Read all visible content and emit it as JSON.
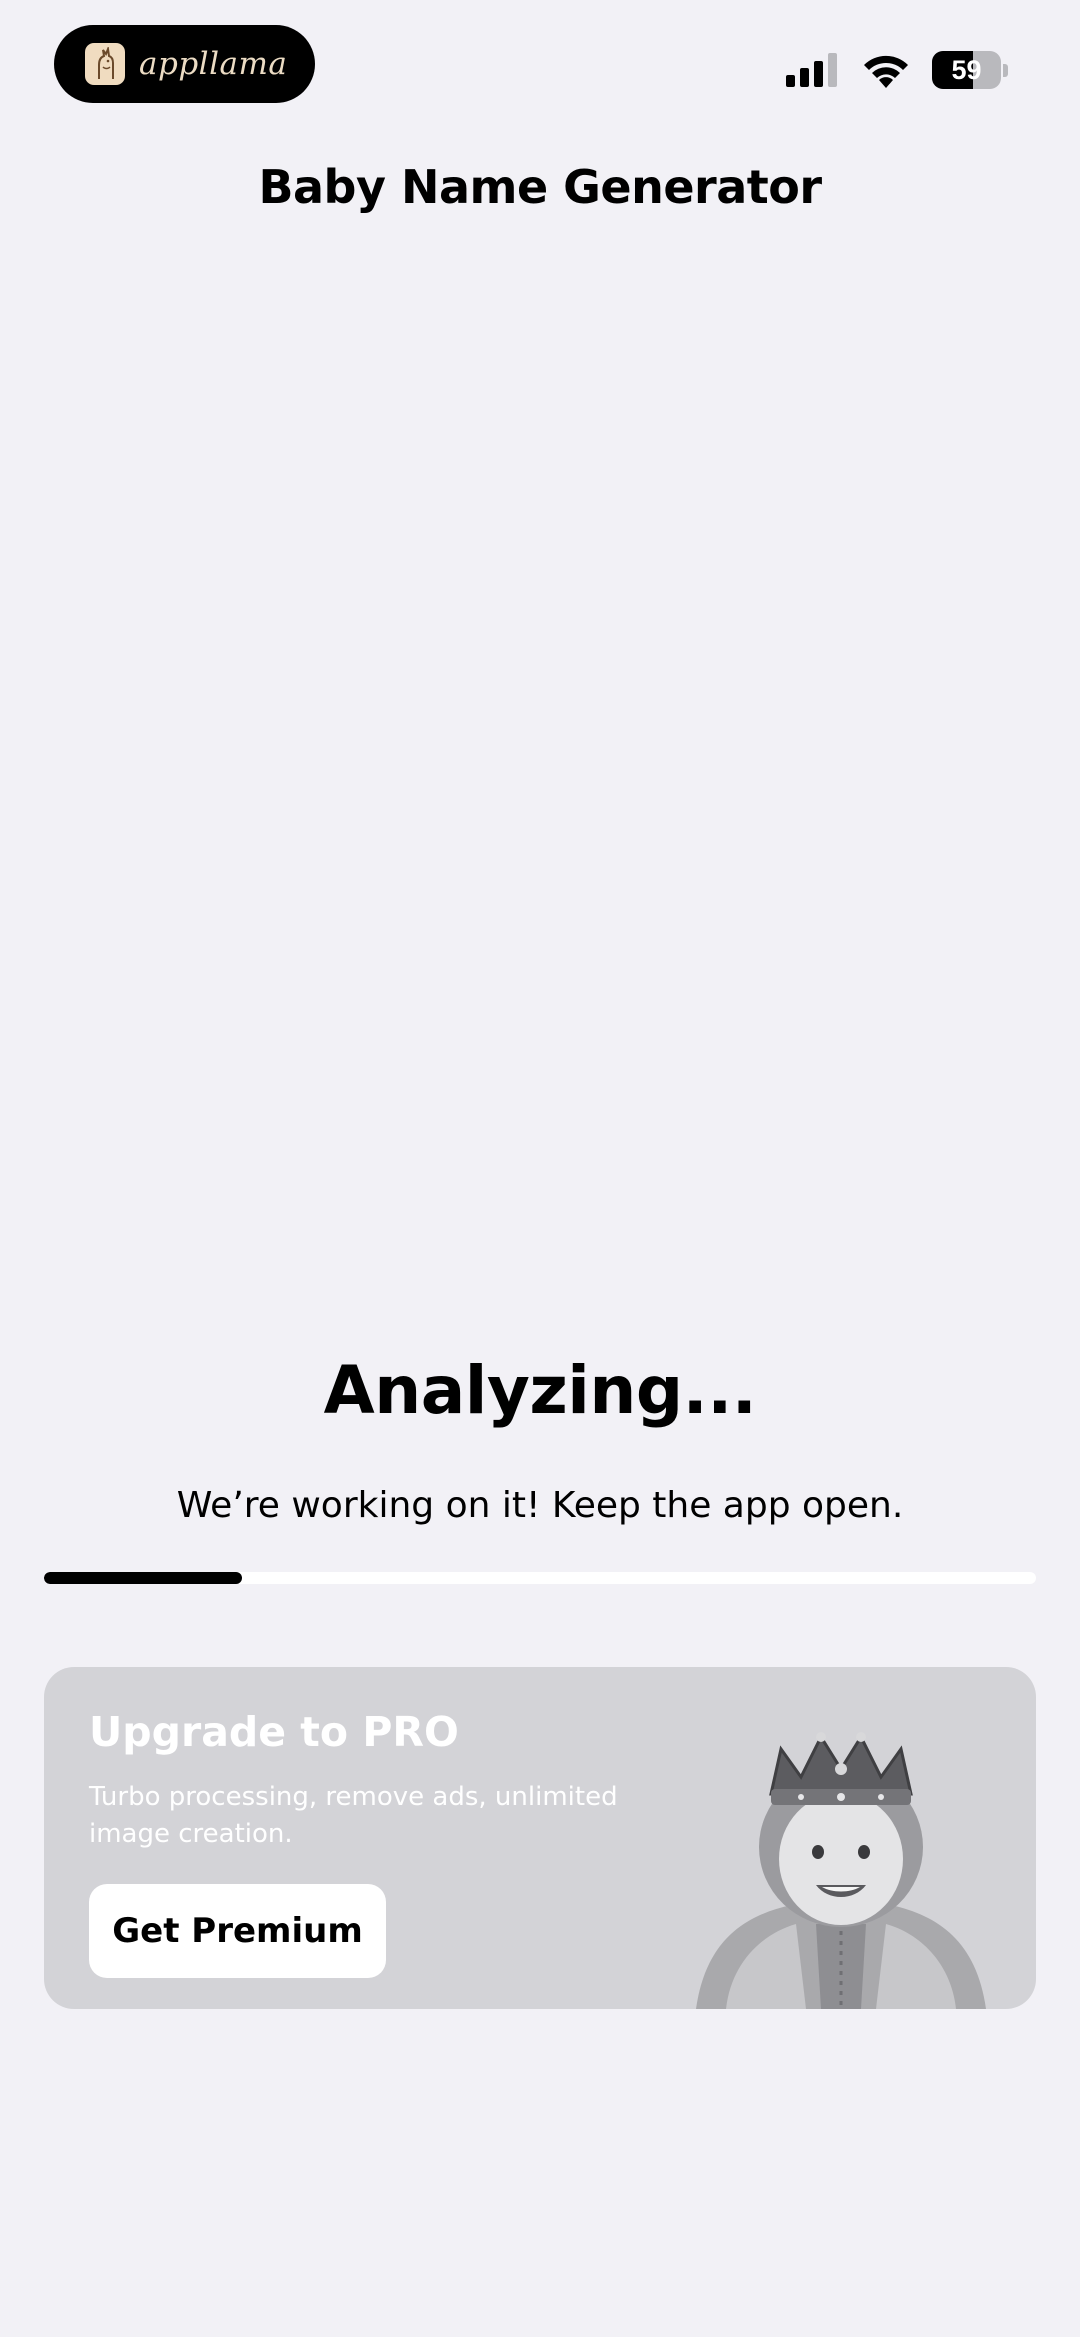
{
  "status_bar": {
    "app_badge_name": "appllama",
    "battery_level": "59",
    "battery_fraction": 0.59
  },
  "header": {
    "title": "Baby Name Generator"
  },
  "progress": {
    "heading": "Analyzing...",
    "message": "We’re working on it! Keep the app open.",
    "fraction": 0.2
  },
  "promo": {
    "title": "Upgrade to PRO",
    "description": "Turbo processing, remove ads, unlimited image creation.",
    "button_label": "Get Premium",
    "image_icon": "crowned-baby-image"
  },
  "colors": {
    "background": "#f2f1f6",
    "card": "#d3d3d7",
    "accent": "#000000"
  }
}
